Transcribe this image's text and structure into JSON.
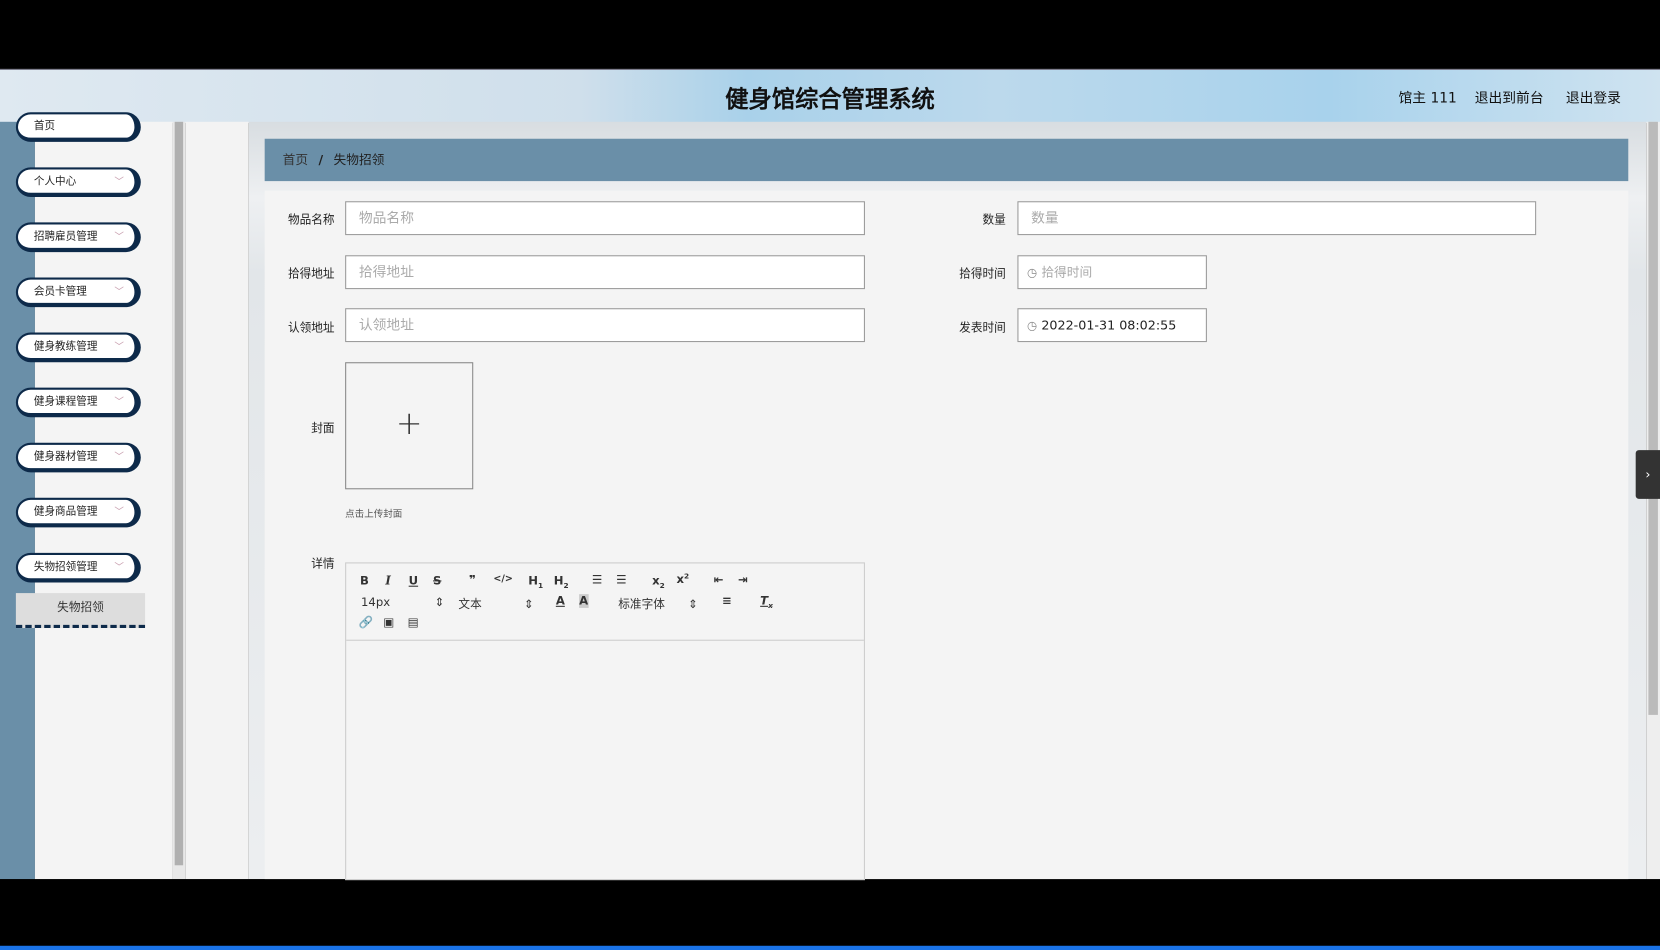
{
  "header": {
    "title": "健身馆综合管理系统",
    "user": "馆主 111",
    "to_front": "退出到前台",
    "logout": "退出登录"
  },
  "sidebar": {
    "items": [
      {
        "label": "首页"
      },
      {
        "label": "个人中心"
      },
      {
        "label": "招聘雇员管理"
      },
      {
        "label": "会员卡管理"
      },
      {
        "label": "健身教练管理"
      },
      {
        "label": "健身课程管理"
      },
      {
        "label": "健身器材管理"
      },
      {
        "label": "健身商品管理"
      },
      {
        "label": "失物招领管理"
      }
    ],
    "sub_item": "失物招领"
  },
  "breadcrumb": {
    "home": "首页",
    "sep": "/",
    "current": "失物招领"
  },
  "form": {
    "name": {
      "label": "物品名称",
      "placeholder": "物品名称",
      "value": ""
    },
    "quantity": {
      "label": "数量",
      "placeholder": "数量",
      "value": ""
    },
    "found_address": {
      "label": "拾得地址",
      "placeholder": "拾得地址",
      "value": ""
    },
    "found_time": {
      "label": "拾得时间",
      "placeholder": "拾得时间"
    },
    "claim_address": {
      "label": "认领地址",
      "placeholder": "认领地址",
      "value": ""
    },
    "publish_time": {
      "label": "发表时间",
      "value": "2022-01-31 08:02:55"
    },
    "cover": {
      "label": "封面",
      "plus": "+",
      "hint": "点击上传封面"
    },
    "detail": {
      "label": "详情",
      "font_size": "14px",
      "heading": "文本",
      "font_family": "标准字体"
    }
  }
}
